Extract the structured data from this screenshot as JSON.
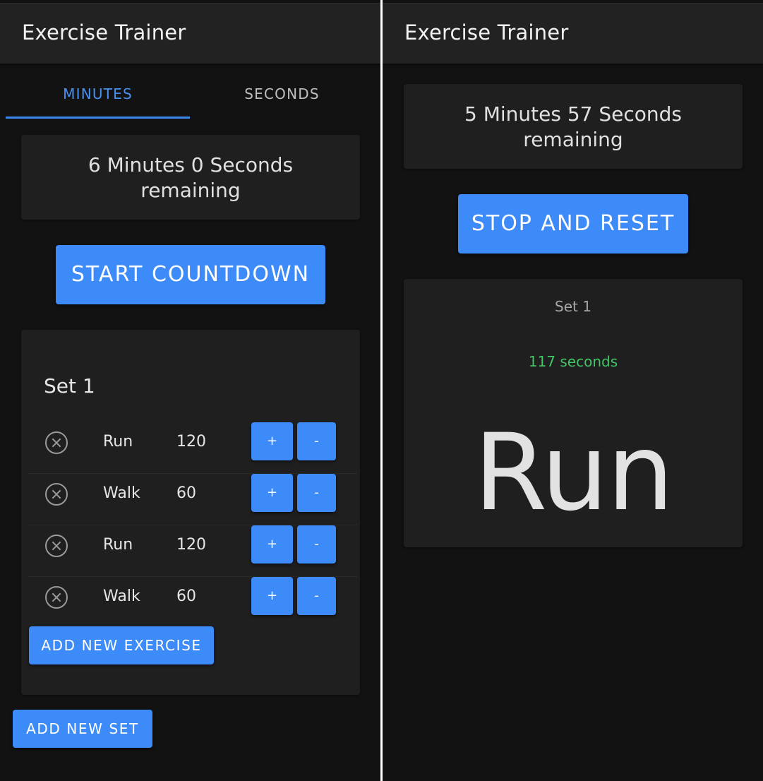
{
  "app": {
    "title": "Exercise Trainer"
  },
  "left": {
    "tabs": [
      {
        "label": "MINUTES",
        "active": true
      },
      {
        "label": "SECONDS",
        "active": false
      }
    ],
    "remaining_line1": "6 Minutes 0 Seconds",
    "remaining_line2": "remaining",
    "start_label": "START COUNTDOWN",
    "set": {
      "title": "Set 1",
      "exercises": [
        {
          "name": "Run",
          "seconds": "120"
        },
        {
          "name": "Walk",
          "seconds": "60"
        },
        {
          "name": "Run",
          "seconds": "120"
        },
        {
          "name": "Walk",
          "seconds": "60"
        }
      ],
      "plus_label": "+",
      "minus_label": "-",
      "add_exercise_label": "ADD NEW EXERCISE"
    },
    "add_set_label": "ADD NEW SET"
  },
  "right": {
    "remaining_line1": "5 Minutes 57 Seconds",
    "remaining_line2": "remaining",
    "stop_label": "STOP AND RESET",
    "set_label": "Set 1",
    "seconds_left": "117 seconds",
    "current_exercise": "Run"
  },
  "colors": {
    "accent": "#3d8bf8",
    "tab_active": "#4a90ee",
    "seconds_green": "#43c466",
    "background": "#121212",
    "card": "#1f1f1f"
  },
  "icons": {
    "remove": "circle-x-icon"
  }
}
